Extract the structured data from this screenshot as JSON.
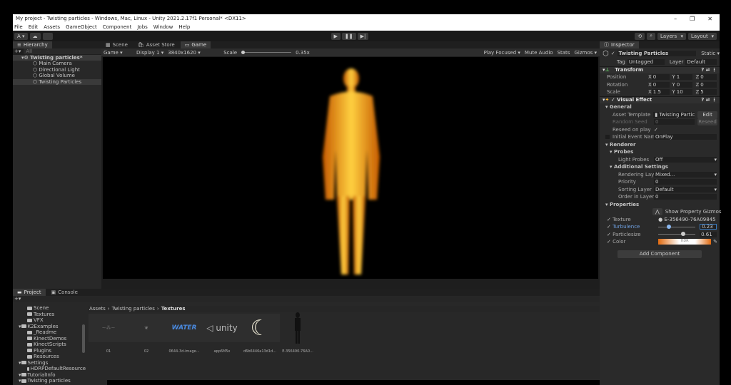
{
  "window": {
    "title": "My project - Twisting particles - Windows, Mac, Linux - Unity 2021.2.17f1 Personal* <DX11>",
    "min": "–",
    "max": "❐",
    "close": "✕"
  },
  "menu": [
    "File",
    "Edit",
    "Assets",
    "GameObject",
    "Component",
    "Jobs",
    "Window",
    "Help"
  ],
  "toolbar": {
    "account": "A ▾",
    "layers": "Layers",
    "layout": "Layout"
  },
  "hierarchy": {
    "tab": "Hierarchy",
    "search": "All",
    "scene": "Twisting particles*",
    "items": [
      "Main Camera",
      "Directional Light",
      "Global Volume",
      "Twisting Particles"
    ]
  },
  "game": {
    "tabs": [
      "Scene",
      "Asset Store",
      "Game"
    ],
    "mode": "Game",
    "display": "Display 1",
    "resolution": "3840x1620",
    "scale_label": "Scale",
    "scale": "0.35x",
    "play_focused": "Play Focused",
    "mute": "Mute Audio",
    "stats": "Stats",
    "gizmos": "Gizmos"
  },
  "inspector": {
    "tab": "Inspector",
    "object": "Twisting Particles",
    "static": "Static",
    "tag_label": "Tag",
    "tag": "Untagged",
    "layer_label": "Layer",
    "layer": "Default",
    "transform": {
      "title": "Transform",
      "rows": [
        {
          "label": "Position",
          "x": "0",
          "y": "1",
          "z": "0"
        },
        {
          "label": "Rotation",
          "x": "0",
          "y": "0",
          "z": "0"
        },
        {
          "label": "Scale",
          "x": "1.5",
          "y": "10",
          "z": "5"
        }
      ]
    },
    "vfx": {
      "title": "Visual Effect",
      "general": "General",
      "asset_template_label": "Asset Template",
      "asset_template": "Twisting Partic",
      "edit": "Edit",
      "random_seed_label": "Random Seed",
      "random_seed": "0",
      "reseed": "Reseed",
      "reseed_on_play": "Reseed on play",
      "initial_event_label": "Initial Event Name",
      "initial_event": "OnPlay",
      "renderer": "Renderer",
      "probes": "Probes",
      "light_probes_label": "Light Probes",
      "light_probes": "Off",
      "additional": "Additional Settings",
      "rendering_layer_label": "Rendering Laye",
      "rendering_layer": "Mixed...",
      "priority_label": "Priority",
      "priority": "0",
      "sorting_layer_label": "Sorting Layer",
      "sorting_layer": "Default",
      "order_label": "Order in Layer",
      "order": "0",
      "properties": "Properties",
      "show_gizmos": "Show Property Gizmos",
      "texture_label": "Texture",
      "texture": "E-356490-76A09845",
      "turbulence_label": "Turbulence",
      "turbulence": "0.23",
      "particlesize_label": "Particlesize",
      "particlesize": "0.61",
      "color_label": "Color",
      "hdr": "HDR"
    },
    "add_component": "Add Component"
  },
  "project": {
    "tabs": [
      "Project",
      "Console"
    ],
    "breadcrumb": [
      "Assets",
      "Twisting particles",
      "Textures"
    ],
    "tree": [
      {
        "name": "Scene",
        "d": 2
      },
      {
        "name": "Textures",
        "d": 2
      },
      {
        "name": "VFX",
        "d": 2
      },
      {
        "name": "K2Examples",
        "d": 1
      },
      {
        "name": "_Readme",
        "d": 2
      },
      {
        "name": "KinectDemos",
        "d": 2
      },
      {
        "name": "KinectScripts",
        "d": 2
      },
      {
        "name": "Plugins",
        "d": 2
      },
      {
        "name": "Resources",
        "d": 2
      },
      {
        "name": "Settings",
        "d": 1
      },
      {
        "name": "HDRPDefaultResource",
        "d": 2
      },
      {
        "name": "TutorialInfo",
        "d": 1
      },
      {
        "name": "Twisting particles",
        "d": 1
      }
    ],
    "assets": [
      "01",
      "02",
      "0644-3d-image...",
      "app6M5x",
      "d6b6446a13d1d...",
      "E-356490-76A0..."
    ],
    "water": "WATER",
    "unity": "unity"
  },
  "colors": {
    "accent": "#3a79bb",
    "fire": "#ffb020"
  }
}
